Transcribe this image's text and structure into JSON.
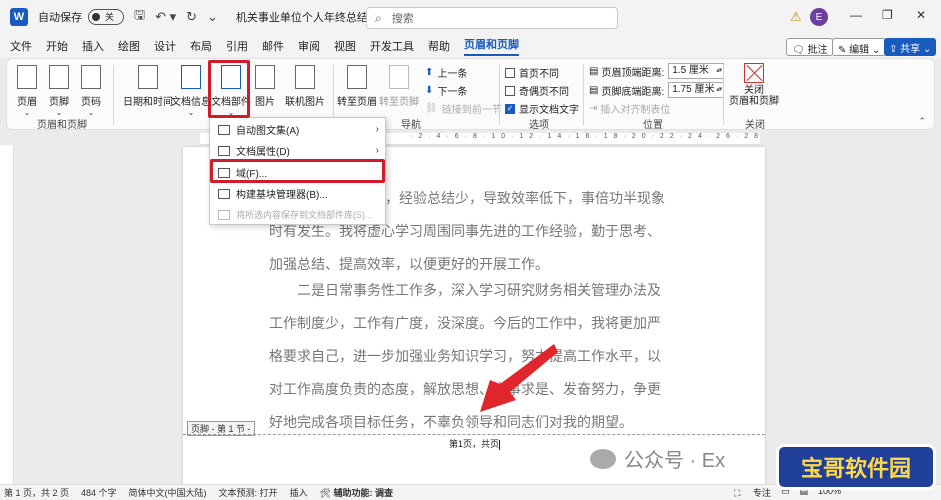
{
  "titlebar": {
    "app_logo": "W",
    "autosave_label": "自动保存",
    "autosave_state": "关",
    "doc_title": "机关事业单位个人年终总结.d...",
    "search_placeholder": "搜索",
    "user_initial": "E"
  },
  "menu_tabs": [
    "文件",
    "开始",
    "插入",
    "绘图",
    "设计",
    "布局",
    "引用",
    "邮件",
    "审阅",
    "视图",
    "开发工具",
    "帮助",
    "页眉和页脚"
  ],
  "active_tab": "页眉和页脚",
  "right_buttons": {
    "comment": "批注",
    "edit": "编辑",
    "share": "共享"
  },
  "ribbon": {
    "header_footer_group": {
      "label": "页眉和页脚",
      "buttons": [
        "页眉",
        "页脚",
        "页码"
      ]
    },
    "insert_group": {
      "buttons": [
        "日期和时间",
        "文档信息",
        "文档部件",
        "图片",
        "联机图片"
      ]
    },
    "navigation_group": {
      "label": "导航",
      "goto_header": "转至页眉",
      "goto_footer": "转至页脚",
      "previous": "上一条",
      "next": "下一条",
      "link_previous": "链接到前一节"
    },
    "options_group": {
      "label": "选项",
      "options": [
        {
          "label": "首页不同",
          "checked": false
        },
        {
          "label": "奇偶页不同",
          "checked": false
        },
        {
          "label": "显示文档文字",
          "checked": true
        }
      ]
    },
    "position_group": {
      "label": "位置",
      "header_distance_label": "页眉顶端距离:",
      "header_distance": "1.5 厘米",
      "footer_distance_label": "页脚底端距离:",
      "footer_distance": "1.75 厘米",
      "align_tab": "插入对齐制表位"
    },
    "close_group": {
      "label": "关闭",
      "button": "关闭\n页眉和页脚"
    }
  },
  "docparts_menu": {
    "items": [
      {
        "label": "自动图文集(A)",
        "submenu": true
      },
      {
        "label": "文档属性(D)",
        "submenu": true
      },
      {
        "label": "域(F)..."
      },
      {
        "label": "构建基块管理器(B)..."
      },
      {
        "label": "将所选内容保存到文档部件库(S)...",
        "disabled": true
      }
    ]
  },
  "document": {
    "paragraphs": [
      "，经验总结少，导致效率低下，事倍功半现象时有发生。我将虚心学习周围同事先进的工作经验，勤于思考、加强总结、提高效率，以便更好的开展工作。",
      "二是日常事务性工作多，深入学习研究财务相关管理办法及工作制度少，工作有广度，没深度。今后的工作中，我将更加严格要求自己，进一步加强业务知识学习，努力提高工作水平，以对工作高度负责的态度，解放思想、实事求是、发奋努力，争更好地完成各项目标任务，不辜负领导和同志们对我的期望。"
    ],
    "footer_tag": "页脚 - 第 1 节 -",
    "footer_text": "第1页，共页"
  },
  "statusbar": {
    "page": "第 1 页，共 2 页",
    "words": "484 个字",
    "language": "简体中文(中国大陆)",
    "prediction": "文本预测: 打开",
    "insert_mode": "插入",
    "accessibility": "辅助功能: 调查",
    "focus": "专注",
    "zoom": "100%"
  },
  "watermark": {
    "wechat": "公众号 · Ex",
    "site_logo": "宝哥软件园"
  },
  "colors": {
    "accent": "#185abd",
    "highlight": "#d11a2a",
    "arrow": "#e0262c"
  }
}
